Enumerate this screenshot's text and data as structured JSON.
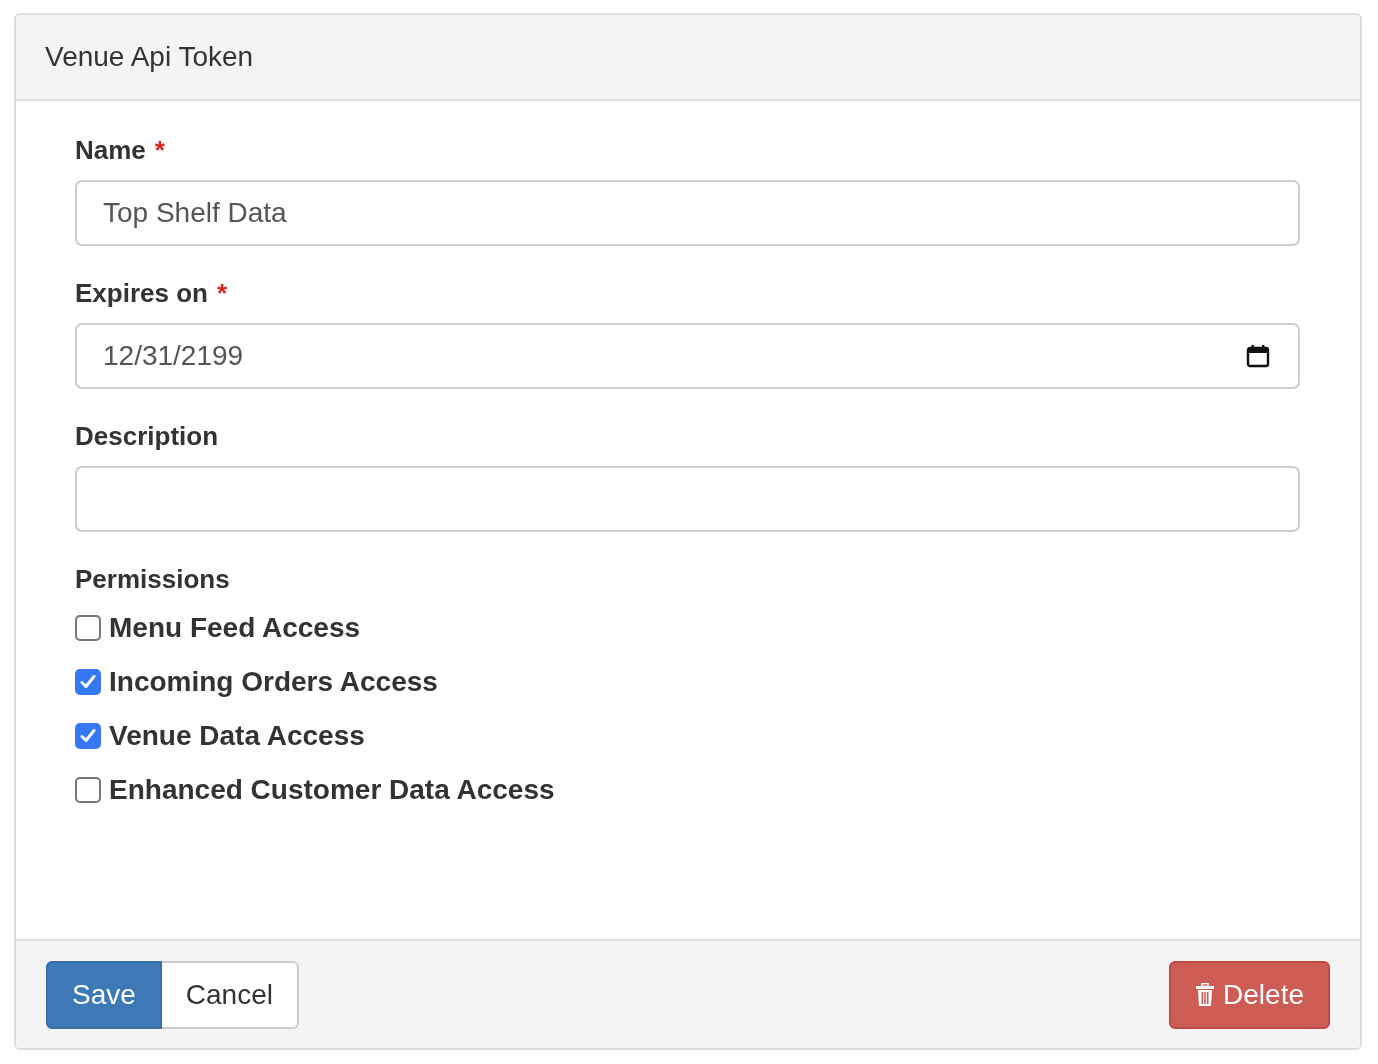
{
  "panel": {
    "title": "Venue Api Token"
  },
  "fields": [
    {
      "kind": "text",
      "label": "Name",
      "required_mark": "*",
      "value": "Top Shelf Data"
    },
    {
      "kind": "date",
      "label": "Expires on",
      "required_mark": "*",
      "value": "12/31/2199"
    },
    {
      "kind": "text",
      "label": "Description"
    }
  ],
  "permissions": {
    "heading": "Permissions",
    "items": [
      {
        "label": "Menu Feed Access",
        "checked": false
      },
      {
        "label": "Incoming Orders Access",
        "checked": true
      },
      {
        "label": "Venue Data Access",
        "checked": true
      },
      {
        "label": "Enhanced Customer Data Access",
        "checked": false
      }
    ]
  },
  "footer": {
    "start_buttons": [
      {
        "label": "Save",
        "kind": "primary"
      },
      {
        "label": "Cancel",
        "kind": "default"
      }
    ],
    "end_buttons": [
      {
        "label": "Delete",
        "kind": "danger"
      }
    ]
  }
}
